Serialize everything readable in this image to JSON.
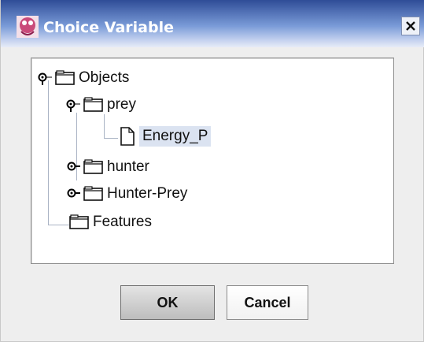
{
  "window": {
    "title": "Choice Variable",
    "icon": "app-icon",
    "close_icon": "close-icon"
  },
  "tree": {
    "root": {
      "label": "Objects",
      "expanded": true
    },
    "prey": {
      "label": "prey",
      "expanded": true
    },
    "energy": {
      "label": "Energy_P",
      "selected": true
    },
    "hunter": {
      "label": "hunter",
      "expanded": false
    },
    "hunter_prey": {
      "label": "Hunter-Prey",
      "expanded": false
    },
    "features": {
      "label": "Features"
    }
  },
  "buttons": {
    "ok": "OK",
    "cancel": "Cancel"
  },
  "colors": {
    "title_bar_top": "#2f4d97",
    "title_bar_bottom": "#e7ecf7",
    "selection": "#dbe3f1",
    "tree_line": "#a9b3c4"
  }
}
